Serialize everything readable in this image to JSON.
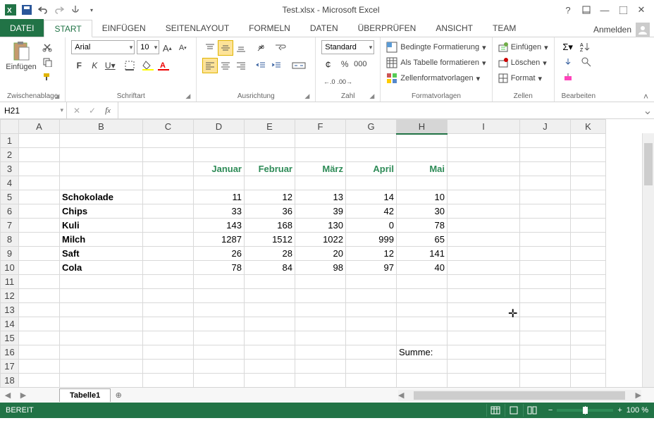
{
  "titlebar": {
    "title": "Test.xlsx - Microsoft Excel"
  },
  "tabs": {
    "file": "DATEI",
    "items": [
      "START",
      "EINFÜGEN",
      "SEITENLAYOUT",
      "FORMELN",
      "DATEN",
      "ÜBERPRÜFEN",
      "ANSICHT",
      "Team"
    ],
    "active_index": 0,
    "signin": "Anmelden"
  },
  "ribbon": {
    "clipboard": {
      "paste": "Einfügen",
      "label": "Zwischenablage"
    },
    "font": {
      "name": "Arial",
      "size": "10",
      "bold": "F",
      "italic": "K",
      "underline": "U",
      "label": "Schriftart"
    },
    "alignment": {
      "label": "Ausrichtung"
    },
    "number": {
      "format": "Standard",
      "label": "Zahl"
    },
    "styles": {
      "cond": "Bedingte Formatierung",
      "table": "Als Tabelle formatieren",
      "cell": "Zellenformatvorlagen",
      "label": "Formatvorlagen"
    },
    "cells": {
      "insert": "Einfügen",
      "delete": "Löschen",
      "format": "Format",
      "label": "Zellen"
    },
    "editing": {
      "label": "Bearbeiten"
    }
  },
  "namebox": "H21",
  "grid": {
    "cols": [
      "A",
      "B",
      "C",
      "D",
      "E",
      "F",
      "G",
      "H",
      "I",
      "J",
      "K"
    ],
    "selected_col": "H",
    "months": [
      "Januar",
      "Februar",
      "März",
      "April",
      "Mai"
    ],
    "products": [
      "Schokolade",
      "Chips",
      "Kuli",
      "Milch",
      "Saft",
      "Cola"
    ],
    "values": [
      [
        11,
        12,
        13,
        14,
        10
      ],
      [
        33,
        36,
        39,
        42,
        30
      ],
      [
        143,
        168,
        130,
        0,
        78
      ],
      [
        1287,
        1512,
        1022,
        999,
        65
      ],
      [
        26,
        28,
        20,
        12,
        141
      ],
      [
        78,
        84,
        98,
        97,
        40
      ]
    ],
    "summe": "Summe:"
  },
  "sheettabs": {
    "active": "Tabelle1"
  },
  "status": {
    "ready": "BEREIT",
    "zoom": "100 %"
  },
  "chart_data": {
    "type": "table",
    "title": "Test.xlsx",
    "columns": [
      "Januar",
      "Februar",
      "März",
      "April",
      "Mai"
    ],
    "rows": [
      "Schokolade",
      "Chips",
      "Kuli",
      "Milch",
      "Saft",
      "Cola"
    ],
    "values": [
      [
        11,
        12,
        13,
        14,
        10
      ],
      [
        33,
        36,
        39,
        42,
        30
      ],
      [
        143,
        168,
        130,
        0,
        78
      ],
      [
        1287,
        1512,
        1022,
        999,
        65
      ],
      [
        26,
        28,
        20,
        12,
        141
      ],
      [
        78,
        84,
        98,
        97,
        40
      ]
    ]
  }
}
